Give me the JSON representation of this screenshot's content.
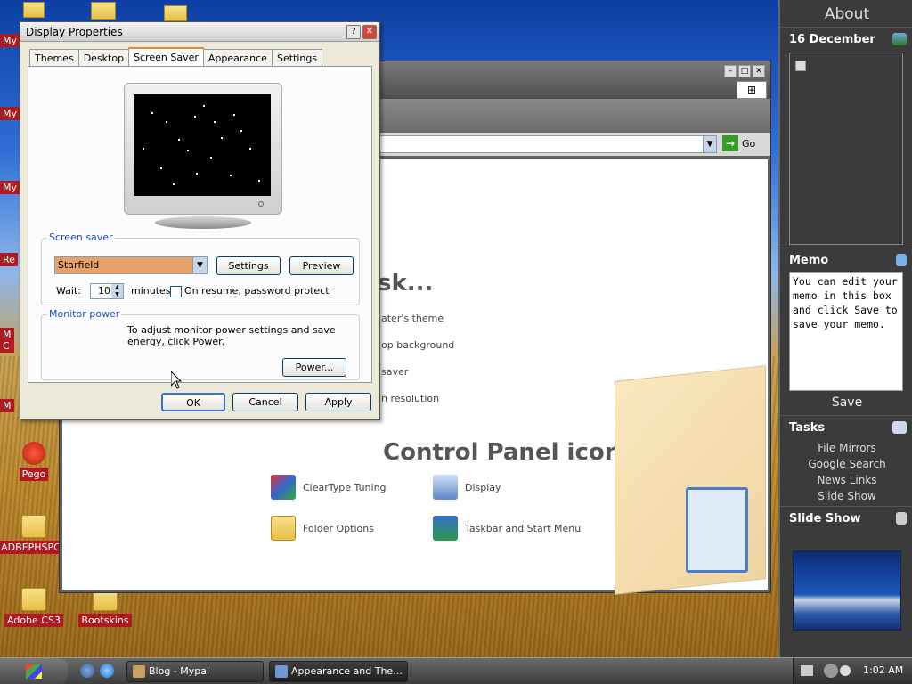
{
  "desktop": {
    "icons": [
      {
        "label": "Pego"
      },
      {
        "label": "ADBEPHSPCS"
      },
      {
        "label": "Adobe CS3"
      },
      {
        "label": "Bootskins"
      }
    ],
    "partial_labels": [
      "My I",
      "My",
      "My",
      "Re",
      "M\nC",
      "M"
    ]
  },
  "background_window": {
    "address": {
      "go_label": "Go"
    },
    "pick_a_task_heading": "sk...",
    "task_links": [
      "ater's theme",
      "op background",
      "saver",
      "n resolution"
    ],
    "pick_icon_heading": "Control Panel icon",
    "items": [
      {
        "label": "ClearType Tuning",
        "icon": "cleartype-icon"
      },
      {
        "label": "Display",
        "icon": "display-icon"
      },
      {
        "label": "Folder Options",
        "icon": "folder-options-icon"
      },
      {
        "label": "Taskbar and Start Menu",
        "icon": "taskbar-icon"
      }
    ]
  },
  "dialog": {
    "title": "Display Properties",
    "help_label": "?",
    "close_label": "✕",
    "tabs": [
      "Themes",
      "Desktop",
      "Screen Saver",
      "Appearance",
      "Settings"
    ],
    "active_tab": "Screen Saver",
    "screen_saver": {
      "group_label": "Screen saver",
      "selected": "Starfield",
      "settings_label": "Settings",
      "preview_label": "Preview",
      "wait_label": "Wait:",
      "wait_value": "10",
      "minutes_label": "minutes",
      "password_label": "On resume, password protect",
      "password_checked": false
    },
    "monitor_power": {
      "group_label": "Monitor power",
      "text": "To adjust monitor power settings and save energy, click Power.",
      "power_label": "Power..."
    },
    "buttons": {
      "ok": "OK",
      "cancel": "Cancel",
      "apply": "Apply"
    }
  },
  "sidebar": {
    "about": "About",
    "date": "16 December",
    "memo_title": "Memo",
    "memo_text": "You can edit your memo in this box and click Save to save your memo.",
    "save_label": "Save",
    "tasks_title": "Tasks",
    "tasks": [
      "File Mirrors",
      "Google Search",
      "News Links",
      "Slide Show"
    ],
    "slideshow_title": "Slide Show"
  },
  "taskbar": {
    "buttons": [
      {
        "label": "Blog - Mypal"
      },
      {
        "label": "Appearance and The..."
      }
    ],
    "clock": "1:02 AM"
  },
  "colors": {
    "sidebar_bg": "#3b3b3b",
    "dialog_bg": "#ece9d8",
    "selection": "#e9a16a",
    "group_caption": "#1f4fbf",
    "label_red": "#b0191f"
  }
}
